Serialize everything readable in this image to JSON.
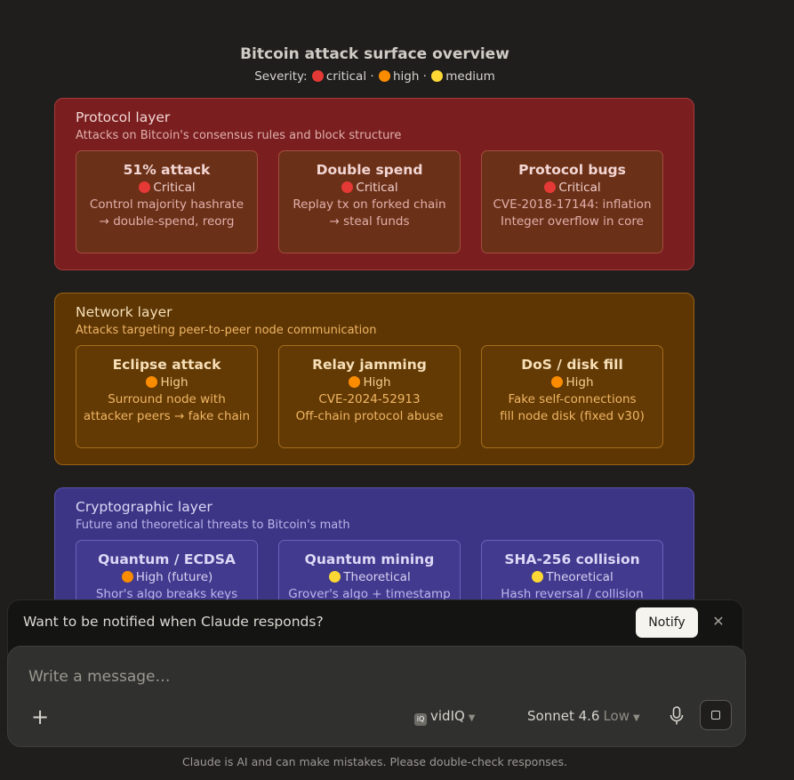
{
  "diagram": {
    "title": "Bitcoin attack surface overview",
    "legend": {
      "prefix": "Severity:",
      "items": [
        {
          "label": "critical",
          "color": "#e53935",
          "sep": " · "
        },
        {
          "label": "high",
          "color": "#fb8c00",
          "sep": " · "
        },
        {
          "label": "medium",
          "color": "#fdd835",
          "sep": ""
        }
      ]
    },
    "layers": [
      {
        "name": "Protocol layer",
        "description": "Attacks on Bitcoin's consensus rules and block structure",
        "cards": [
          {
            "name": "51% attack",
            "severity": "Critical",
            "icon": "red-circle",
            "desc1": "Control majority hashrate",
            "desc2": "→ double-spend, reorg"
          },
          {
            "name": "Double spend",
            "severity": "Critical",
            "icon": "red-circle",
            "desc1": "Replay tx on forked chain",
            "desc2": "→ steal funds"
          },
          {
            "name": "Protocol bugs",
            "severity": "Critical",
            "icon": "red-circle",
            "desc1": "CVE-2018-17144: inflation",
            "desc2": "Integer overflow in core"
          }
        ]
      },
      {
        "name": "Network layer",
        "description": "Attacks targeting peer-to-peer node communication",
        "cards": [
          {
            "name": "Eclipse attack",
            "severity": "High",
            "icon": "orange-circle",
            "desc1": "Surround node with",
            "desc2": "attacker peers → fake chain"
          },
          {
            "name": "Relay jamming",
            "severity": "High",
            "icon": "orange-circle",
            "desc1": "CVE-2024-52913",
            "desc2": "Off-chain protocol abuse"
          },
          {
            "name": "DoS / disk fill",
            "severity": "High",
            "icon": "orange-circle",
            "desc1": "Fake self-connections",
            "desc2": "fill node disk (fixed v30)"
          }
        ]
      },
      {
        "name": "Cryptographic layer",
        "description": "Future and theoretical threats to Bitcoin's math",
        "cards": [
          {
            "name": "Quantum / ECDSA",
            "severity": "High (future)",
            "icon": "orange-circle",
            "desc1": "Shor's algo breaks keys",
            "desc2": ""
          },
          {
            "name": "Quantum mining",
            "severity": "Theoretical",
            "icon": "yellow-circle",
            "desc1": "Grover's algo + timestamp",
            "desc2": ""
          },
          {
            "name": "SHA-256 collision",
            "severity": "Theoretical",
            "icon": "yellow-circle",
            "desc1": "Hash reversal / collision",
            "desc2": ""
          }
        ]
      }
    ]
  },
  "notification": {
    "text": "Want to be notified when Claude responds?",
    "button": "Notify",
    "close_icon": "close-icon"
  },
  "composer": {
    "placeholder": "Write a message…",
    "tool_name": "vidIQ",
    "model_name": "Sonnet 4.6",
    "effort": "Low"
  },
  "footer": "Claude is AI and can make mistakes. Please double-check responses."
}
